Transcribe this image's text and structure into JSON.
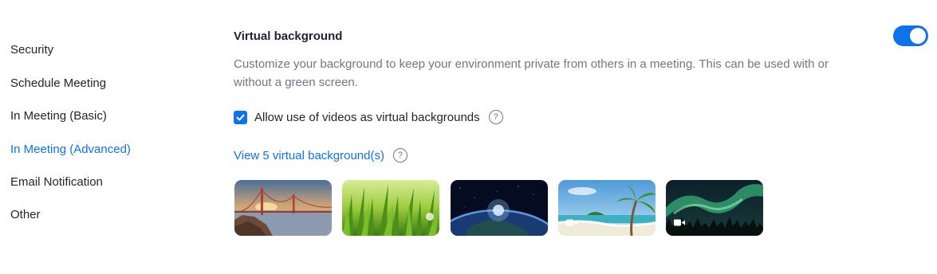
{
  "sidebar": {
    "items": [
      {
        "label": "Security",
        "active": false
      },
      {
        "label": "Schedule Meeting",
        "active": false
      },
      {
        "label": "In Meeting (Basic)",
        "active": false
      },
      {
        "label": "In Meeting (Advanced)",
        "active": true
      },
      {
        "label": "Email Notification",
        "active": false
      },
      {
        "label": "Other",
        "active": false
      }
    ]
  },
  "virtual_background": {
    "title": "Virtual background",
    "description": "Customize your background to keep your environment private from others in a meeting. This can be used with or without a green screen.",
    "enabled": true,
    "allow_videos": {
      "label": "Allow use of videos as virtual backgrounds",
      "checked": true
    },
    "view_link": "View 5 virtual background(s)",
    "thumbnails": [
      {
        "subject": "golden-gate-bridge",
        "video": false
      },
      {
        "subject": "grass",
        "video": false
      },
      {
        "subject": "earth-from-space",
        "video": false
      },
      {
        "subject": "beach-palm",
        "video": true
      },
      {
        "subject": "aurora",
        "video": true
      }
    ]
  },
  "colors": {
    "accent": "#0e72ed",
    "text": "#232333",
    "muted": "#747487"
  }
}
